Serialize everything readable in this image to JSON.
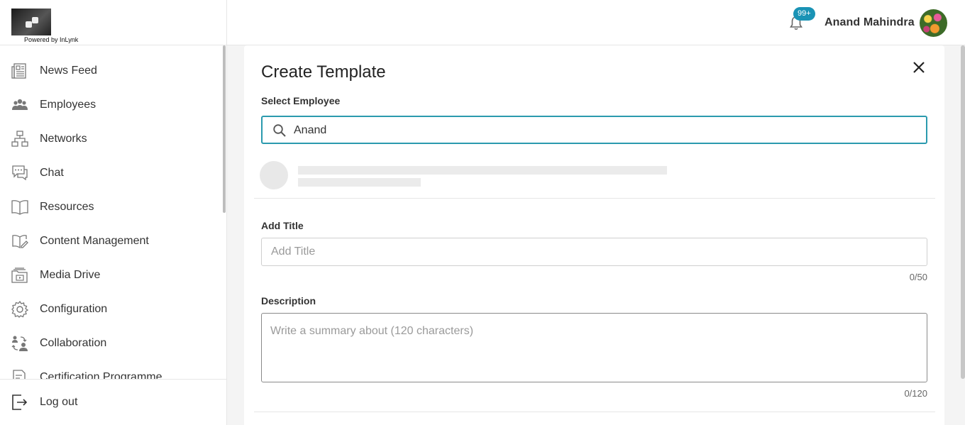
{
  "header": {
    "logo_caption": "Powered by InLynk",
    "notification_badge": "99+",
    "user_name": "Anand Mahindra"
  },
  "sidebar": {
    "items": [
      {
        "label": "News Feed",
        "icon": "news-feed-icon"
      },
      {
        "label": "Employees",
        "icon": "employees-icon"
      },
      {
        "label": "Networks",
        "icon": "networks-icon"
      },
      {
        "label": "Chat",
        "icon": "chat-icon"
      },
      {
        "label": "Resources",
        "icon": "book-icon"
      },
      {
        "label": "Content Management",
        "icon": "content-management-icon"
      },
      {
        "label": "Media Drive",
        "icon": "media-drive-icon"
      },
      {
        "label": "Configuration",
        "icon": "gear-icon"
      },
      {
        "label": "Collaboration",
        "icon": "collaboration-icon"
      },
      {
        "label": "Certification Programme",
        "icon": "certificate-icon"
      }
    ],
    "logout_label": "Log out"
  },
  "modal": {
    "title": "Create Template",
    "select_employee_label": "Select Employee",
    "search_value": "Anand",
    "add_title_label": "Add Title",
    "title_placeholder": "Add Title",
    "title_counter": "0/50",
    "description_label": "Description",
    "description_placeholder": "Write a summary about (120 characters)",
    "description_counter": "0/120"
  },
  "colors": {
    "accent": "#2b9aae",
    "badge": "#1a93b5"
  }
}
